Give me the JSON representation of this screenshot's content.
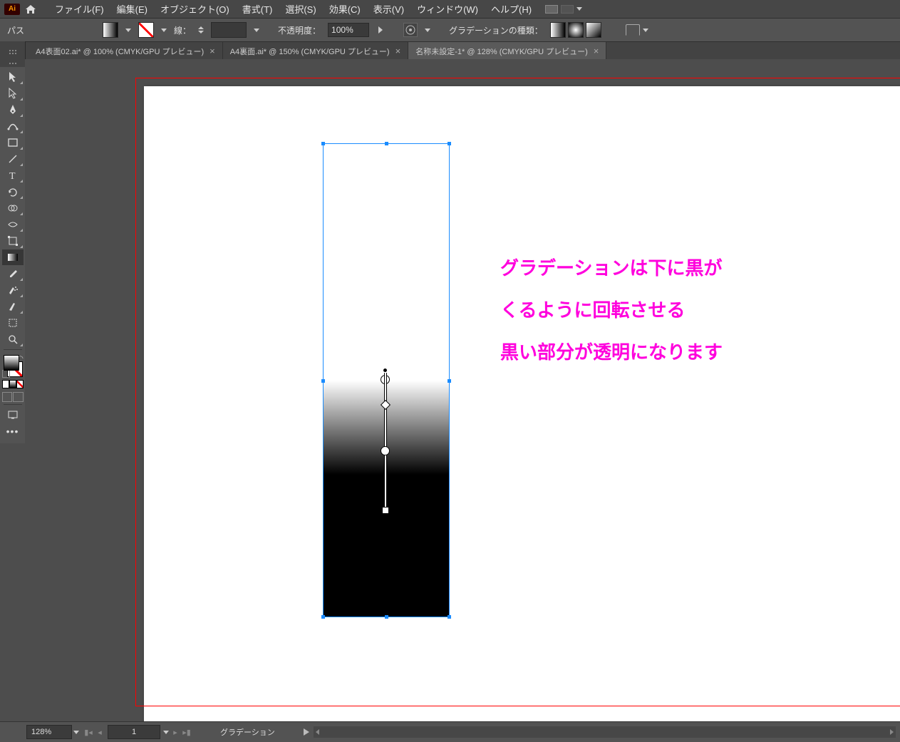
{
  "menu": {
    "app_abbrev": "Ai",
    "items": [
      "ファイル(F)",
      "編集(E)",
      "オブジェクト(O)",
      "書式(T)",
      "選択(S)",
      "効果(C)",
      "表示(V)",
      "ウィンドウ(W)",
      "ヘルプ(H)"
    ]
  },
  "control": {
    "selection_type": "パス",
    "stroke_label": "線：",
    "opacity_label": "不透明度：",
    "opacity_value": "100%",
    "gradient_type_label": "グラデーションの種類："
  },
  "tabs": [
    {
      "label": "A4表面02.ai* @ 100% (CMYK/GPU プレビュー)",
      "active": false
    },
    {
      "label": "A4裏面.ai* @ 150% (CMYK/GPU プレビュー)",
      "active": false
    },
    {
      "label": "名称未設定-1* @ 128% (CMYK/GPU プレビュー)",
      "active": true
    }
  ],
  "annotation": {
    "line1": "グラデーションは下に黒が",
    "line2": "くるように回転させる",
    "line3": "黒い部分が透明になります"
  },
  "status": {
    "zoom": "128%",
    "page": "1",
    "tool": "グラデーション"
  }
}
